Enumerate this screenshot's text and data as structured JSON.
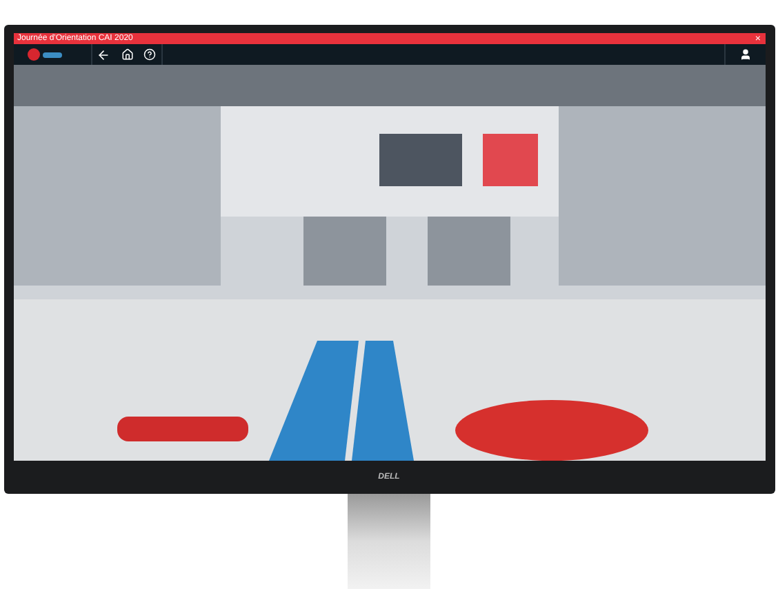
{
  "window": {
    "title": "Journée d'Orientation CAI 2020",
    "close": "×"
  },
  "monitor": {
    "brand": "DELL"
  }
}
